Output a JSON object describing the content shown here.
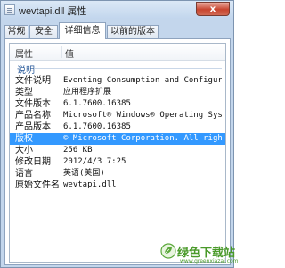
{
  "window": {
    "title": "wevtapi.dll 属性",
    "close_label": "x"
  },
  "tabs": [
    {
      "label": "常规"
    },
    {
      "label": "安全"
    },
    {
      "label": "详细信息"
    },
    {
      "label": "以前的版本"
    }
  ],
  "columns": {
    "property": "属性",
    "value": "值"
  },
  "group": {
    "label": "说明"
  },
  "rows": [
    {
      "name": "文件说明",
      "value": "Eventing Consumption and Configur..."
    },
    {
      "name": "类型",
      "value": "应用程序扩展"
    },
    {
      "name": "文件版本",
      "value": "6.1.7600.16385"
    },
    {
      "name": "产品名称",
      "value": "Microsoft® Windows® Operating System"
    },
    {
      "name": "产品版本",
      "value": "6.1.7600.16385"
    },
    {
      "name": "版权",
      "value": "© Microsoft Corporation. All righ..."
    },
    {
      "name": "大小",
      "value": "256 KB"
    },
    {
      "name": "修改日期",
      "value": "2012/4/3 7:25"
    },
    {
      "name": "语言",
      "value": "英语(美国)"
    },
    {
      "name": "原始文件名",
      "value": "wevtapi.dll"
    }
  ],
  "watermark": {
    "text": "绿色下载站",
    "url": "www.greenxiazai.com",
    "color": "#4a9a2a"
  },
  "selection_color": "#3399ff"
}
